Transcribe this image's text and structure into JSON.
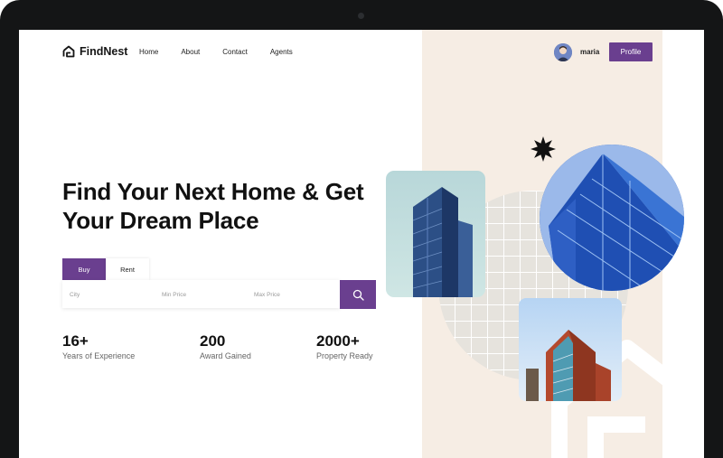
{
  "app": {
    "name": "FindNest"
  },
  "nav": {
    "items": [
      "Home",
      "About",
      "Contact",
      "Agents"
    ]
  },
  "user": {
    "name": "maria",
    "profile_label": "Profile"
  },
  "hero": {
    "title": "Find Your Next Home & Get Your Dream Place"
  },
  "search": {
    "tabs": [
      "Buy",
      "Rent"
    ],
    "active_tab": "Buy",
    "city_placeholder": "City",
    "min_price_placeholder": "Min Price",
    "max_price_placeholder": "Max Price",
    "button_icon": "search-icon"
  },
  "stats": [
    {
      "value": "16+",
      "label": "Years of Experience"
    },
    {
      "value": "200",
      "label": "Award Gained"
    },
    {
      "value": "2000+",
      "label": "Property Ready"
    }
  ],
  "colors": {
    "accent": "#6a3f8f",
    "beige_panel": "#f6ede4",
    "text_dark": "#111111"
  }
}
